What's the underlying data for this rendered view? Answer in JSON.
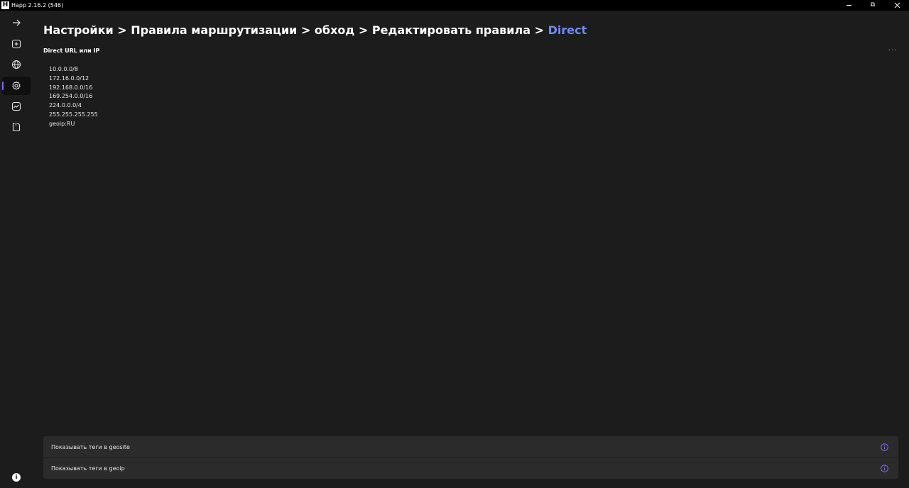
{
  "window": {
    "title": "Happ 2.16.2 (546)",
    "logo_letter": "H",
    "restore_glyph": "⧉"
  },
  "sidebar": {
    "items": [
      {
        "icon": "arrow-right-icon",
        "active": false
      },
      {
        "icon": "add-square-icon",
        "active": false
      },
      {
        "icon": "globe-icon",
        "active": false
      },
      {
        "icon": "gear-icon",
        "active": true
      },
      {
        "icon": "chart-icon",
        "active": false
      },
      {
        "icon": "power-icon",
        "active": false
      }
    ],
    "info_glyph": "i"
  },
  "breadcrumb": {
    "items": [
      "Настройки",
      "Правила маршрутизации",
      "обход",
      "Редактировать правила"
    ],
    "separator": ">",
    "current": "Direct"
  },
  "section": {
    "title": "Direct URL или IP",
    "more_glyph": "···"
  },
  "rules": [
    "10.0.0.0/8",
    "172.16.0.0/12",
    "192.168.0.0/16",
    "169.254.0.0/16",
    "224.0.0.0/4",
    "255.255.255.255",
    "geoip:RU"
  ],
  "settings": [
    {
      "label": "Показывать теги в geosite",
      "icon": "info-icon"
    },
    {
      "label": "Показывать теги в geoip",
      "icon": "info-icon"
    }
  ],
  "colors": {
    "background": "#1c1c1c",
    "accent": "#7a6cf2",
    "breadcrumb_current": "#6e8cf5",
    "card": "#2b2b2b"
  }
}
